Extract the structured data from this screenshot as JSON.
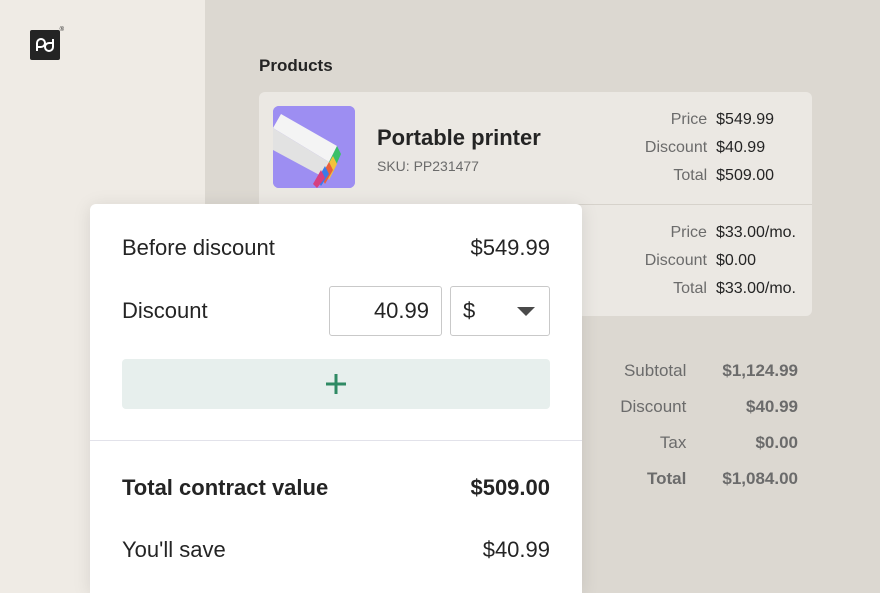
{
  "brand": {
    "logo_icon": "pandadoc-logo-icon",
    "mark": "®"
  },
  "products": {
    "heading": "Products",
    "items": [
      {
        "name": "Portable printer",
        "sku": "SKU: PP231477",
        "thumb_color": "#9d8ef2",
        "price_label": "Price",
        "price": "$549.99",
        "discount_label": "Discount",
        "discount": "$40.99",
        "total_label": "Total",
        "total": "$509.00"
      },
      {
        "price_label": "Price",
        "price": "$33.00/mo.",
        "discount_label": "Discount",
        "discount": "$0.00",
        "total_label": "Total",
        "total": "$33.00/mo."
      }
    ]
  },
  "summary": {
    "subtotal_label": "Subtotal",
    "subtotal": "$1,124.99",
    "discount_label": "Discount",
    "discount": "$40.99",
    "tax_label": "Tax",
    "tax": "$0.00",
    "total_label": "Total",
    "total": "$1,084.00"
  },
  "popup": {
    "before_label": "Before discount",
    "before_value": "$549.99",
    "discount_label": "Discount",
    "discount_value": "40.99",
    "currency": "$",
    "add_icon": "plus-icon",
    "total_contract_label": "Total contract value",
    "total_contract_value": "$509.00",
    "save_label": "You'll save",
    "save_value": "$40.99"
  },
  "colors": {
    "accent_green": "#2f8a64",
    "add_button_bg": "#e7efed",
    "card_bg": "#ebe8e3",
    "panel_bg": "#dcd8d1"
  }
}
